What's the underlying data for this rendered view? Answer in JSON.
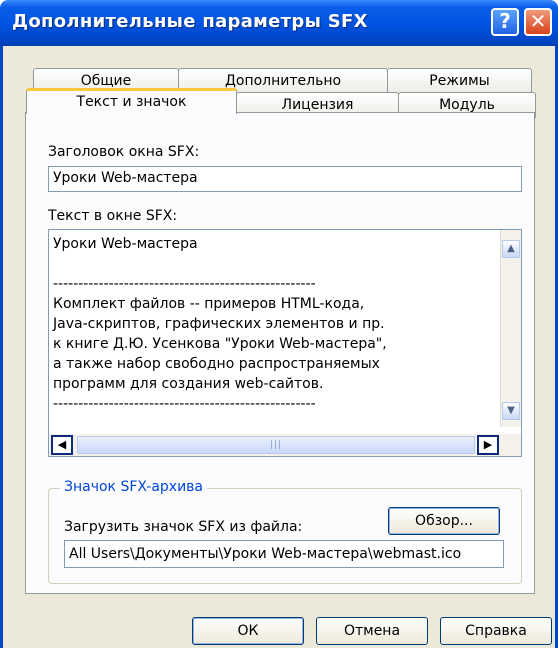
{
  "window": {
    "title": "Дополнительные параметры SFX",
    "help_glyph": "?",
    "close_glyph": "✕"
  },
  "tabs": {
    "row1": [
      "Общие",
      "Дополнительно",
      "Режимы"
    ],
    "row2": [
      "Текст и значок",
      "Лицензия",
      "Модуль"
    ],
    "active": "Текст и значок"
  },
  "fields": {
    "title_label": "Заголовок окна SFX:",
    "title_value": "Уроки Web-мастера",
    "text_label": "Текст в окне SFX:",
    "text_value": "Уроки Web-мастера\n\n----------------------------------------------------\nКомплект файлов -- примеров HTML-кода,\nJava-скриптов, графических элементов и пр.\nк книге Д.Ю. Усенкова \"Уроки Web-мастера\",\nа также набор свободно распространяемых\nпрограмм для создания web-сайтов.\n----------------------------------------------------"
  },
  "icon_group": {
    "legend": "Значок SFX-архива",
    "load_label": "Загрузить значок SFX из файла:",
    "browse_label": "Обзор...",
    "path_value": "All Users\\Документы\\Уроки Web-мастера\\webmast.ico"
  },
  "footer": {
    "ok": "ОК",
    "cancel": "Отмена",
    "help": "Справка"
  },
  "icons": {
    "scroll_up": "up-arrow-icon",
    "scroll_down": "down-arrow-icon",
    "scroll_left": "left-arrow-icon",
    "scroll_right": "right-arrow-icon"
  }
}
